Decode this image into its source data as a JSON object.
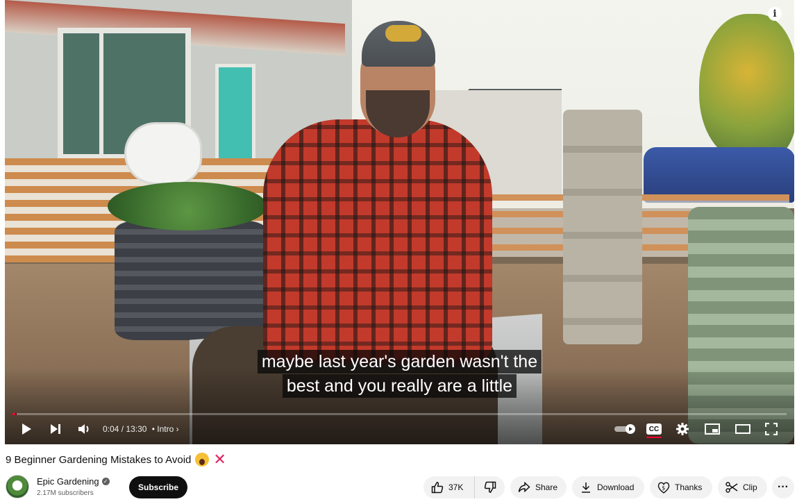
{
  "player": {
    "captions": [
      "maybe last year's garden wasn't the",
      "best and you really are a little"
    ],
    "time_current": "0:04",
    "time_separator": "/",
    "time_total": "13:30",
    "chapter_label": "• Intro",
    "chapter_chevron": "›",
    "progress_fraction": 0.005,
    "cc_label": "CC",
    "accent_color": "#ff0033"
  },
  "video": {
    "title": "9 Beginner Gardening Mistakes to Avoid"
  },
  "channel": {
    "name": "Epic Gardening",
    "subscribers": "2.17M subscribers",
    "subscribe_label": "Subscribe"
  },
  "actions": {
    "like_count": "37K",
    "share_label": "Share",
    "download_label": "Download",
    "thanks_label": "Thanks",
    "clip_label": "Clip",
    "more_label": "···"
  }
}
